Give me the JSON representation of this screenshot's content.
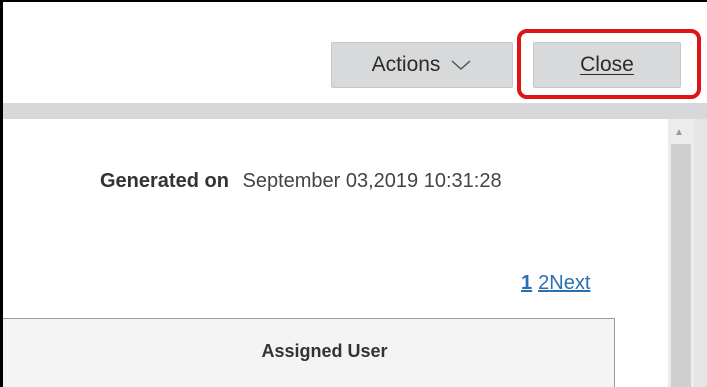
{
  "toolbar": {
    "actions_label": "Actions",
    "actions_icon": "chevron-down-icon",
    "close_label": "Close",
    "highlight_color": "#e01414"
  },
  "report": {
    "generated_label": "Generated on",
    "generated_value": "September 03,2019 10:31:28"
  },
  "pager": {
    "current": "1",
    "page2": "2",
    "next": "Next"
  },
  "table": {
    "columns": [
      "Assigned User"
    ]
  }
}
